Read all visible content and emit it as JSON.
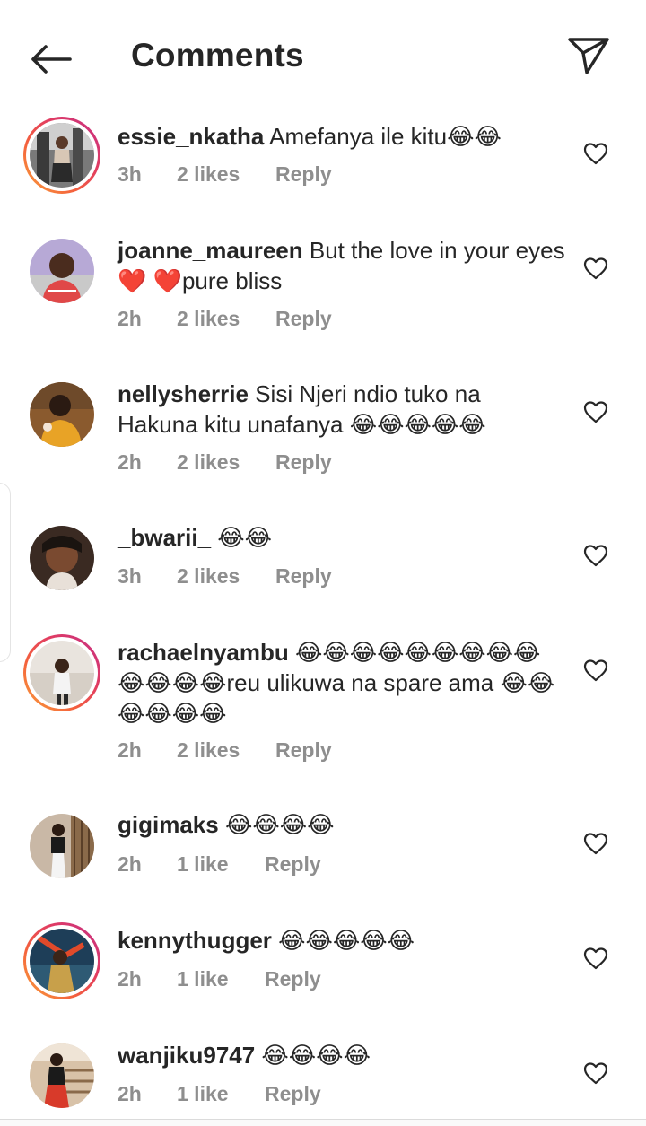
{
  "header": {
    "title": "Comments",
    "back_icon": "arrow-left-icon",
    "share_icon": "paper-plane-icon"
  },
  "comments": [
    {
      "username": "essie_nkatha",
      "text": " Amefanya ile kitu😂😂",
      "time": "3h",
      "likes": "2 likes",
      "reply": "Reply",
      "has_story": true
    },
    {
      "username": "joanne_maureen",
      "text": " But the love in your eyes ❤️ ❤️pure bliss",
      "time": "2h",
      "likes": "2 likes",
      "reply": "Reply",
      "has_story": false
    },
    {
      "username": "nellysherrie",
      "text": " Sisi Njeri ndio tuko na Hakuna kitu unafanya 😂😂😂😂😂",
      "time": "2h",
      "likes": "2 likes",
      "reply": "Reply",
      "has_story": false
    },
    {
      "username": "_bwarii_",
      "text": " 😂😂",
      "time": "3h",
      "likes": "2 likes",
      "reply": "Reply",
      "has_story": false
    },
    {
      "username": "rachaelnyambu",
      "text": " 😂😂😂😂😂😂😂😂😂😂😂😂😂reu ulikuwa na spare ama 😂😂😂😂😂😂",
      "time": "2h",
      "likes": "2 likes",
      "reply": "Reply",
      "has_story": true
    },
    {
      "username": "gigimaks",
      "text": " 😂😂😂😂",
      "time": "2h",
      "likes": "1 like",
      "reply": "Reply",
      "has_story": false
    },
    {
      "username": "kennythugger",
      "text": " 😂😂😂😂😂",
      "time": "2h",
      "likes": "1 like",
      "reply": "Reply",
      "has_story": true
    },
    {
      "username": "wanjiku9747",
      "text": " 😂😂😂😂",
      "time": "2h",
      "likes": "1 like",
      "reply": "Reply",
      "has_story": false
    }
  ],
  "icons": {
    "heart": "heart-outline-icon",
    "avatar": "avatar-photo"
  },
  "colors": {
    "text": "#262626",
    "meta": "#8e8e8e",
    "story_ring_start": "#f9a23b",
    "story_ring_end": "#c42f86"
  }
}
